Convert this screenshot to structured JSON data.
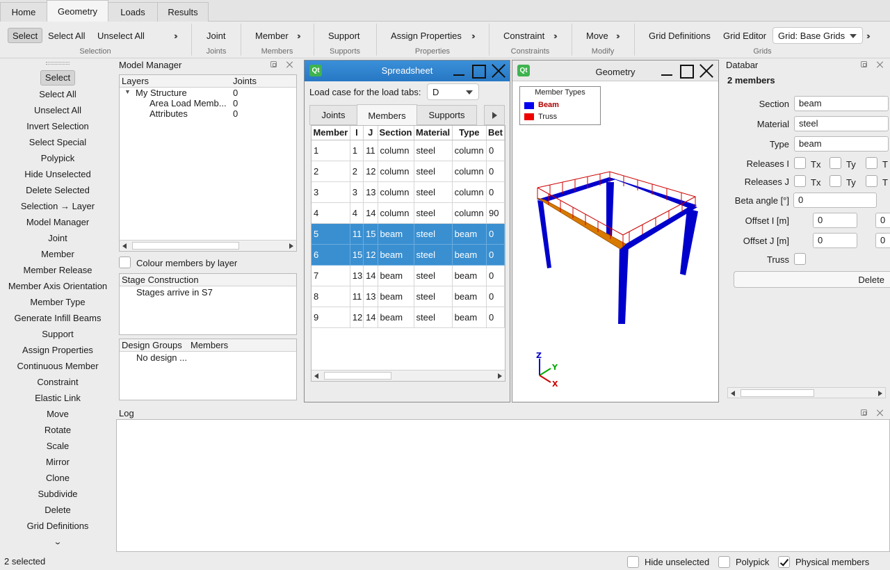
{
  "tabs": [
    "Home",
    "Geometry",
    "Loads",
    "Results"
  ],
  "ribbon": {
    "selection": {
      "select": "Select",
      "select_all": "Select All",
      "unselect_all": "Unselect All",
      "label": "Selection"
    },
    "joints": {
      "joint": "Joint",
      "label": "Joints"
    },
    "members": {
      "member": "Member",
      "label": "Members"
    },
    "supports": {
      "support": "Support",
      "label": "Supports"
    },
    "properties": {
      "assign": "Assign Properties",
      "label": "Properties"
    },
    "constraints": {
      "constraint": "Constraint",
      "label": "Constraints"
    },
    "modify": {
      "move": "Move",
      "label": "Modify"
    },
    "grids": {
      "grid_definitions": "Grid Definitions",
      "grid_editor": "Grid Editor",
      "grid_combo": "Grid: Base Grids",
      "label": "Grids"
    }
  },
  "left_toolbar": [
    "Select",
    "Select All",
    "Unselect All",
    "Invert Selection",
    "Select Special",
    "Polypick",
    "Hide Unselected",
    "Delete Selected",
    "Selection → Layer",
    "Model Manager",
    "Joint",
    "Member",
    "Member Release",
    "Member Axis Orientation",
    "Member Type",
    "Generate Infill Beams",
    "Support",
    "Assign Properties",
    "Continuous Member",
    "Constraint",
    "Elastic Link",
    "Move",
    "Rotate",
    "Scale",
    "Mirror",
    "Clone",
    "Subdivide",
    "Delete",
    "Grid Definitions"
  ],
  "model_manager": {
    "title": "Model Manager",
    "headers": [
      "Layers",
      "Joints"
    ],
    "tree": [
      {
        "label": "My Structure",
        "value": "0"
      },
      {
        "label": "Area Load Memb...",
        "value": "0"
      },
      {
        "label": "Attributes",
        "value": "0"
      }
    ],
    "colour_by_layer": "Colour members by layer",
    "stage_header": "Stage Construction",
    "stage_item": "Stages arrive in S7",
    "design_headers": [
      "Design Groups",
      "Members"
    ],
    "design_item": "No design ..."
  },
  "spreadsheet": {
    "title": "Spreadsheet",
    "load_case_label": "Load case for the load tabs:",
    "load_case": "D",
    "tabs": [
      "Joints",
      "Members",
      "Supports"
    ],
    "columns": [
      "Member",
      "I",
      "J",
      "Section",
      "Material",
      "Type",
      "Bet"
    ],
    "rows": [
      [
        "1",
        "1",
        "11",
        "column",
        "steel",
        "column",
        "0"
      ],
      [
        "2",
        "2",
        "12",
        "column",
        "steel",
        "column",
        "0"
      ],
      [
        "3",
        "3",
        "13",
        "column",
        "steel",
        "column",
        "0"
      ],
      [
        "4",
        "4",
        "14",
        "column",
        "steel",
        "column",
        "90"
      ],
      [
        "5",
        "11",
        "15",
        "beam",
        "steel",
        "beam",
        "0"
      ],
      [
        "6",
        "15",
        "12",
        "beam",
        "steel",
        "beam",
        "0"
      ],
      [
        "7",
        "13",
        "14",
        "beam",
        "steel",
        "beam",
        "0"
      ],
      [
        "8",
        "11",
        "13",
        "beam",
        "steel",
        "beam",
        "0"
      ],
      [
        "9",
        "12",
        "14",
        "beam",
        "steel",
        "beam",
        "0"
      ]
    ],
    "selected_rows": [
      4,
      5
    ]
  },
  "geometry": {
    "title": "Geometry",
    "legend_title": "Member Types",
    "legend": [
      {
        "label": "Beam",
        "color": "#0000ee"
      },
      {
        "label": "Truss",
        "color": "#ee0000"
      }
    ],
    "axes": {
      "z": "Z",
      "y": "Y",
      "x": "X"
    }
  },
  "databar": {
    "title": "Databar",
    "summary": "2 members",
    "section_label": "Section",
    "section": "beam",
    "material_label": "Material",
    "material": "steel",
    "type_label": "Type",
    "type": "beam",
    "releases_i": "Releases I",
    "releases_j": "Releases J",
    "tx": "Tx",
    "ty": "Ty",
    "tz": "T",
    "beta_label": "Beta angle [°]",
    "beta": "0",
    "offset_i_label": "Offset I [m]",
    "offset_i": "0",
    "offset_i2": "0",
    "offset_j_label": "Offset J [m]",
    "offset_j": "0",
    "offset_j2": "0",
    "truss_label": "Truss",
    "delete": "Delete"
  },
  "log": {
    "title": "Log"
  },
  "status": {
    "selected": "2 selected",
    "hide_unselected": "Hide unselected",
    "polypick": "Polypick",
    "physical_members": "Physical members"
  },
  "colors": {
    "selection": "#3a8fd0",
    "member": "#0000cc",
    "selected_member": "#d97a00",
    "load": "#cc0000"
  }
}
